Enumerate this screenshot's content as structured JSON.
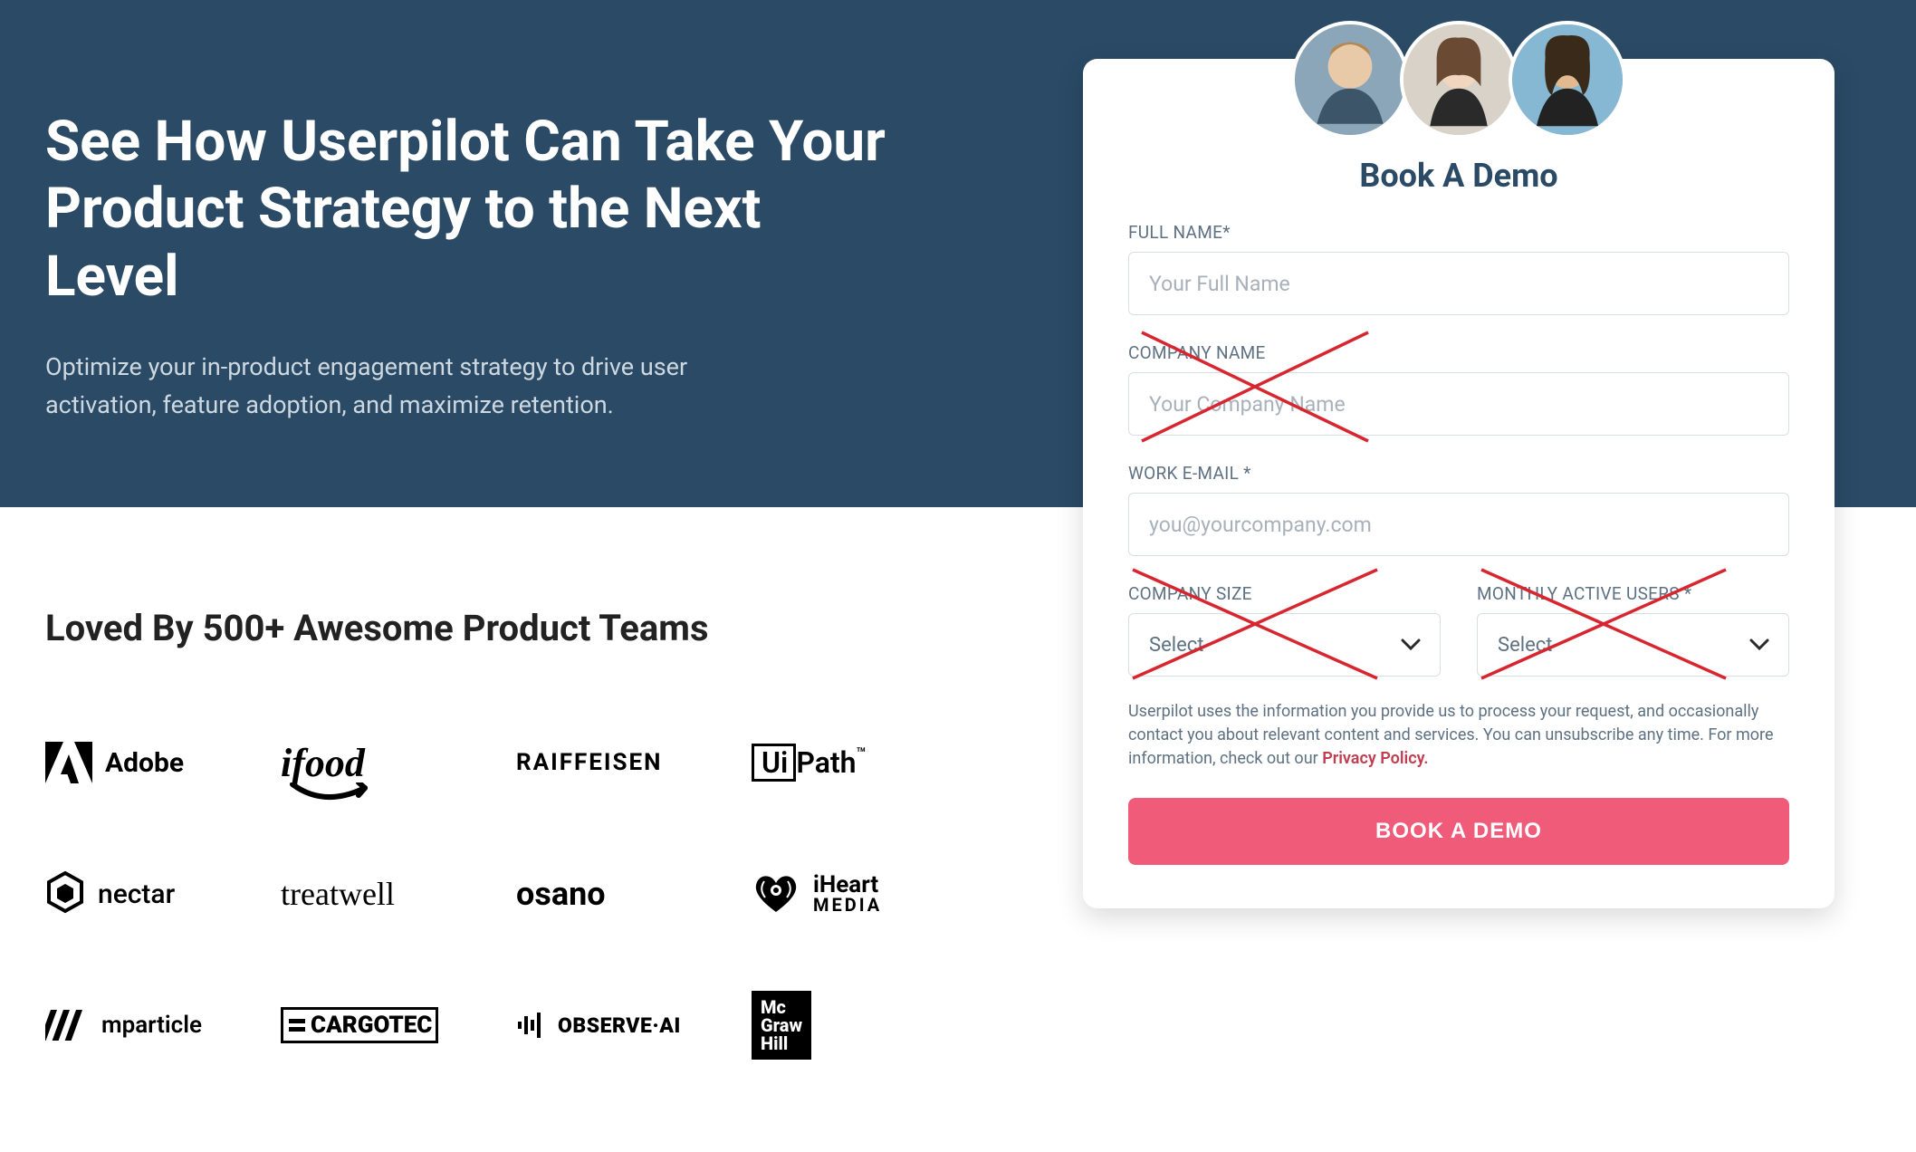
{
  "hero": {
    "heading": "See How Userpilot Can Take Your Product Strategy to the Next Level",
    "subheading": "Optimize your in-product engagement strategy to drive user activation, feature adoption, and maximize retention."
  },
  "social": {
    "heading": "Loved By 500+ Awesome Product Teams",
    "logos": [
      "Adobe",
      "ifood",
      "RAIFFEISEN",
      "UiPath",
      "nectar",
      "treatwell",
      "osano",
      "iHeart MEDIA",
      "mparticle",
      "CARGOTEC",
      "OBSERVE·AI",
      "Mc Graw Hill"
    ]
  },
  "form": {
    "title": "Book A Demo",
    "full_name": {
      "label": "FULL NAME*",
      "placeholder": "Your Full Name"
    },
    "company_name": {
      "label": "COMPANY NAME",
      "placeholder": "Your Company Name"
    },
    "work_email": {
      "label": "WORK E-MAIL *",
      "placeholder": "you@yourcompany.com"
    },
    "company_size": {
      "label": "COMPANY SIZE",
      "placeholder": "Select"
    },
    "mau": {
      "label": "MONTHLY ACTIVE USERS *",
      "placeholder": "Select"
    },
    "disclaimer_prefix": "Userpilot uses the information you provide us to process your request, and occasionally contact you about relevant content and services. You can unsubscribe any time. For more information, check out our ",
    "privacy_label": "Privacy Policy.",
    "submit": "BOOK A DEMO"
  },
  "annotations": {
    "crossed_out_fields": [
      "company_name",
      "company_size",
      "mau"
    ]
  }
}
